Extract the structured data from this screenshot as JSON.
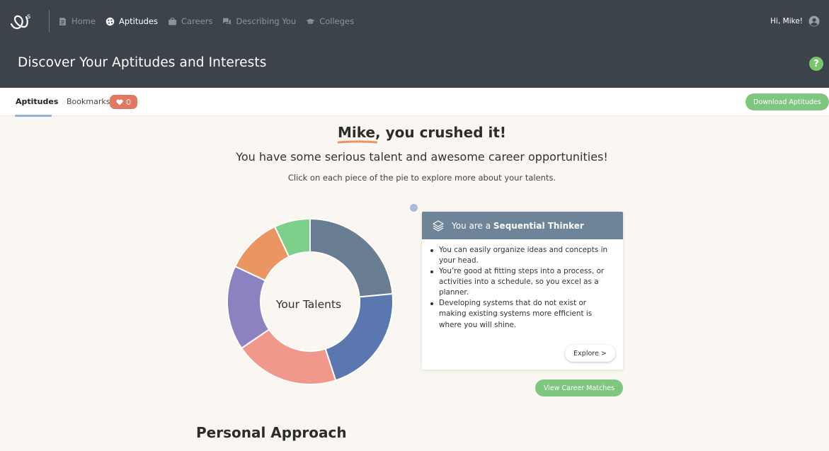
{
  "nav": {
    "items": [
      {
        "label": "Home",
        "icon": "document-icon",
        "active": false
      },
      {
        "label": "Aptitudes",
        "icon": "palette-icon",
        "active": true
      },
      {
        "label": "Careers",
        "icon": "briefcase-icon",
        "active": false
      },
      {
        "label": "Describing You",
        "icon": "chat-bubbles-icon",
        "active": false
      },
      {
        "label": "Colleges",
        "icon": "graduation-cap-icon",
        "active": false
      }
    ],
    "greeting": "Hi, Mike!"
  },
  "header": {
    "title": "Discover Your Aptitudes and Interests",
    "help": "?"
  },
  "tabs": {
    "aptitudes": "Aptitudes",
    "bookmarks": "Bookmarks",
    "bookmark_count": "0",
    "download": "Download Aptitudes"
  },
  "hero": {
    "name": "Mike,",
    "headline_rest": "you crushed it!",
    "subhead": "You have some serious talent and awesome career opportunities!",
    "instruction": "Click on each piece of the pie to explore more about your talents."
  },
  "donut": {
    "center_label": "Your Talents",
    "segments": [
      {
        "color": "#687d92",
        "fraction": 0.235
      },
      {
        "color": "#5a77b0",
        "fraction": 0.215
      },
      {
        "color": "#f0998a",
        "fraction": 0.205
      },
      {
        "color": "#8b82bf",
        "fraction": 0.165
      },
      {
        "color": "#ea9562",
        "fraction": 0.11
      },
      {
        "color": "#7dd08a",
        "fraction": 0.07
      }
    ]
  },
  "card": {
    "prefix": "You are a",
    "type": "Sequential Thinker",
    "bullets": [
      "You can easily organize ideas and concepts in your head.",
      "You’re good at fitting steps into a process, or activities into a schedule, so you excel as a planner.",
      "Developing systems that do not exist or making existing systems more efficient is where you will shine."
    ],
    "explore": "Explore >",
    "career_matches": "View Career Matches"
  },
  "section": {
    "title": "Personal Approach"
  }
}
